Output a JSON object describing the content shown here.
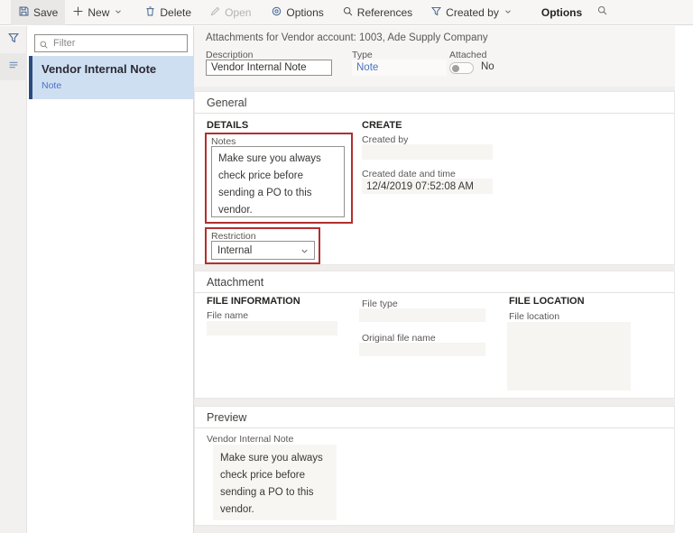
{
  "toolbar": {
    "buttons": [
      {
        "label": "Save",
        "icon": "save-icon"
      },
      {
        "label": "New",
        "icon": "plus-icon"
      },
      {
        "label": "Delete",
        "icon": "trash-icon"
      },
      {
        "label": "Open",
        "icon": "pencil-icon"
      },
      {
        "label": "Options",
        "icon": "gear-icon"
      },
      {
        "label": "References",
        "icon": "magnifier-icon"
      },
      {
        "label": "Created by",
        "icon": "funnel-icon"
      }
    ],
    "menu_label": "Options"
  },
  "sidebar": {
    "filter_placeholder": "Filter",
    "items": [
      {
        "title": "Vendor Internal Note",
        "subtitle": "Note",
        "selected": true
      }
    ]
  },
  "header": {
    "title": "Attachments for Vendor account: 1003, Ade Supply Company",
    "description_label": "Description",
    "description_value": "Vendor Internal Note",
    "type_label": "Type",
    "type_value": "Note",
    "attached_label": "Attached",
    "attached_value": "No"
  },
  "general": {
    "title": "General",
    "details_group": "DETAILS",
    "notes_label": "Notes",
    "notes_value": "Make sure you always check price before sending a PO to this vendor.",
    "restriction_label": "Restriction",
    "restriction_value": "Internal",
    "create_group": "CREATE",
    "created_by_label": "Created by",
    "created_by_value": "",
    "created_date_label": "Created date and time",
    "created_date_value": "12/4/2019 07:52:08 AM"
  },
  "attachment": {
    "title": "Attachment",
    "file_information_group": "FILE INFORMATION",
    "file_name_label": "File name",
    "file_name_value": "",
    "file_type_label": "File type",
    "file_type_value": "",
    "original_file_name_label": "Original file name",
    "original_file_name_value": "",
    "file_location_group": "FILE LOCATION",
    "file_location_label": "File location",
    "file_location_value": ""
  },
  "preview": {
    "title": "Preview",
    "item_label": "Vendor Internal Note",
    "text": "Make sure you always check price before sending a PO to this vendor."
  },
  "colors": {
    "accent_blue": "#40618f",
    "link_blue": "#4a72c4",
    "selected_item_bg": "#cfdff2",
    "selected_item_border": "#2b4d7e",
    "annotation_red": "#b22f2f"
  }
}
